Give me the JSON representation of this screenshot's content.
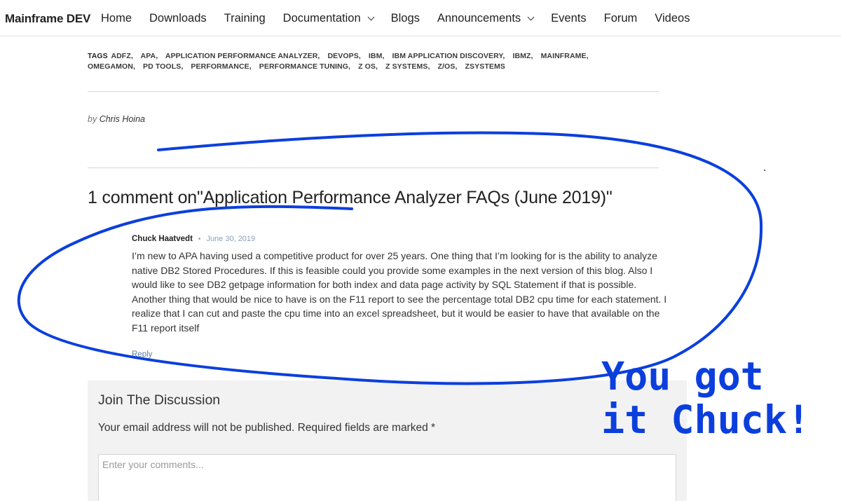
{
  "nav": {
    "brand": "Mainframe DEV",
    "items": [
      {
        "label": "Home",
        "dropdown": false
      },
      {
        "label": "Downloads",
        "dropdown": false
      },
      {
        "label": "Training",
        "dropdown": false
      },
      {
        "label": "Documentation",
        "dropdown": true
      },
      {
        "label": "Blogs",
        "dropdown": false
      },
      {
        "label": "Announcements",
        "dropdown": true
      },
      {
        "label": "Events",
        "dropdown": false
      },
      {
        "label": "Forum",
        "dropdown": false
      },
      {
        "label": "Videos",
        "dropdown": false
      }
    ]
  },
  "post": {
    "tags_label": "TAGS",
    "tags": [
      "ADFZ",
      "APA",
      "APPLICATION PERFORMANCE ANALYZER",
      "DEVOPS",
      "IBM",
      "IBM APPLICATION DISCOVERY",
      "IBMZ",
      "MAINFRAME",
      "OMEGAMON",
      "PD TOOLS",
      "PERFORMANCE",
      "PERFORMANCE TUNING",
      "Z OS",
      "Z SYSTEMS",
      "Z/OS",
      "ZSYSTEMS"
    ],
    "by_label": "by",
    "author": "Chris Hoina"
  },
  "comments": {
    "title": "1 comment on\"Application Performance Analyzer FAQs (June 2019)\"",
    "items": [
      {
        "author": "Chuck Haatvedt",
        "separator": "•",
        "date": "June 30, 2019",
        "body": "I’m new to APA having used a competitive product for over 25 years. One thing that I’m looking for is the ability to analyze native DB2 Stored Procedures. If this is feasible could you provide some examples in the next version of this blog. Also I would like to see DB2 getpage information for both index and data page activity by SQL Statement if that is possible. Another thing that would be nice to have is on the F11 report to see the percentage total DB2 cpu time for each statement. I realize that I can cut and paste the cpu time into an excel spreadsheet, but it would be easier to have that available on the F11 report itself",
        "reply_label": "Reply"
      }
    ]
  },
  "discussion": {
    "title": "Join The Discussion",
    "note": "Your email address will not be published. Required fields are marked *",
    "comment_placeholder": "Enter your comments..."
  },
  "annotation": {
    "line1": "You got",
    "line2": "it Chuck!",
    "color": "#0b3fdd"
  }
}
